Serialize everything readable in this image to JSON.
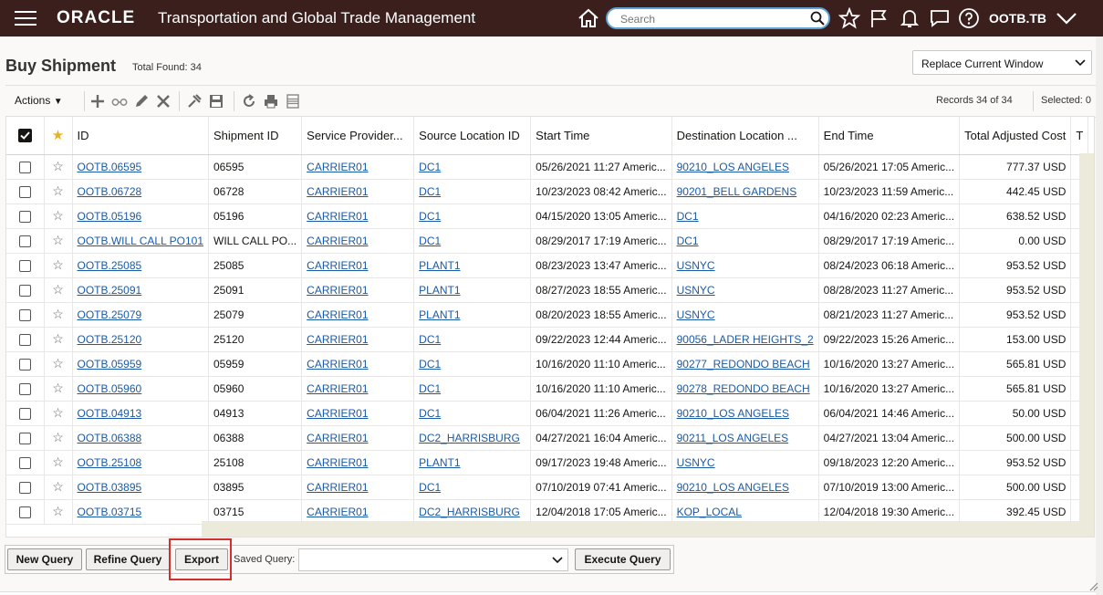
{
  "header": {
    "logo": "ORACLE",
    "app_title": "Transportation and Global Trade Management",
    "search_placeholder": "Search",
    "user": "OOTB.TB"
  },
  "page": {
    "title": "Buy Shipment",
    "total_found": "Total Found: 34",
    "window_mode": "Replace Current Window"
  },
  "toolbar": {
    "actions_label": "Actions",
    "records_text": "Records  34  of  34",
    "selected_text": "Selected: 0"
  },
  "grid": {
    "columns": [
      "ID",
      "Shipment ID",
      "Service Provider...",
      "Source Location ID",
      "Start Time",
      "Destination Location ...",
      "End Time",
      "Total Adjusted Cost",
      "T"
    ],
    "rows": [
      [
        "OOTB.06595",
        "06595",
        "CARRIER01",
        "DC1",
        "05/26/2021 11:27 Americ...",
        "90210_LOS ANGELES",
        "05/26/2021 17:05 Americ...",
        "777.37 USD"
      ],
      [
        "OOTB.06728",
        "06728",
        "CARRIER01",
        "DC1",
        "10/23/2023 08:42 Americ...",
        "90201_BELL GARDENS",
        "10/23/2023 11:59 Americ...",
        "442.45 USD"
      ],
      [
        "OOTB.05196",
        "05196",
        "CARRIER01",
        "DC1",
        "04/15/2020 13:05 Americ...",
        "DC1",
        "04/16/2020 02:23 Americ...",
        "638.52 USD"
      ],
      [
        "OOTB.WILL CALL PO101",
        "WILL CALL PO...",
        "CARRIER01",
        "DC1",
        "08/29/2017 17:19 Americ...",
        "DC1",
        "08/29/2017 17:19 Americ...",
        "0.00 USD"
      ],
      [
        "OOTB.25085",
        "25085",
        "CARRIER01",
        "PLANT1",
        "08/23/2023 13:47 Americ...",
        "USNYC",
        "08/24/2023 06:18 Americ...",
        "953.52 USD"
      ],
      [
        "OOTB.25091",
        "25091",
        "CARRIER01",
        "PLANT1",
        "08/27/2023 18:55 Americ...",
        "USNYC",
        "08/28/2023 11:27 Americ...",
        "953.52 USD"
      ],
      [
        "OOTB.25079",
        "25079",
        "CARRIER01",
        "PLANT1",
        "08/20/2023 18:55 Americ...",
        "USNYC",
        "08/21/2023 11:27 Americ...",
        "953.52 USD"
      ],
      [
        "OOTB.25120",
        "25120",
        "CARRIER01",
        "DC1",
        "09/22/2023 12:44 Americ...",
        "90056_LADER HEIGHTS_2",
        "09/22/2023 15:26 Americ...",
        "153.00 USD"
      ],
      [
        "OOTB.05959",
        "05959",
        "CARRIER01",
        "DC1",
        "10/16/2020 11:10 Americ...",
        "90277_REDONDO BEACH",
        "10/16/2020 13:27 Americ...",
        "565.81 USD"
      ],
      [
        "OOTB.05960",
        "05960",
        "CARRIER01",
        "DC1",
        "10/16/2020 11:10 Americ...",
        "90278_REDONDO BEACH",
        "10/16/2020 13:27 Americ...",
        "565.81 USD"
      ],
      [
        "OOTB.04913",
        "04913",
        "CARRIER01",
        "DC1",
        "06/04/2021 11:26 Americ...",
        "90210_LOS ANGELES",
        "06/04/2021 14:46 Americ...",
        "50.00 USD"
      ],
      [
        "OOTB.06388",
        "06388",
        "CARRIER01",
        "DC2_HARRISBURG",
        "04/27/2021 16:04 Americ...",
        "90211_LOS ANGELES",
        "04/27/2021 13:04 Americ...",
        "500.00 USD"
      ],
      [
        "OOTB.25108",
        "25108",
        "CARRIER01",
        "PLANT1",
        "09/17/2023 19:48 Americ...",
        "USNYC",
        "09/18/2023 12:20 Americ...",
        "953.52 USD"
      ],
      [
        "OOTB.03895",
        "03895",
        "CARRIER01",
        "DC1",
        "07/10/2019 07:41 Americ...",
        "90210_LOS ANGELES",
        "07/10/2019 13:00 Americ...",
        "500.00 USD"
      ],
      [
        "OOTB.03715",
        "03715",
        "CARRIER01",
        "DC2_HARRISBURG",
        "12/04/2018 17:05 Americ...",
        "KOP_LOCAL",
        "12/04/2018 19:30 Americ...",
        "392.45 USD"
      ]
    ]
  },
  "bottom": {
    "new_query": "New Query",
    "refine_query": "Refine Query",
    "export": "Export",
    "saved_query_label": "Saved Query:",
    "saved_query_value": "",
    "execute_query": "Execute Query"
  },
  "colors": {
    "header_bg": "#3a1f1c",
    "link": "#1a5aa6",
    "highlight": "#d32f2f",
    "search_border": "#5fa3d6"
  }
}
